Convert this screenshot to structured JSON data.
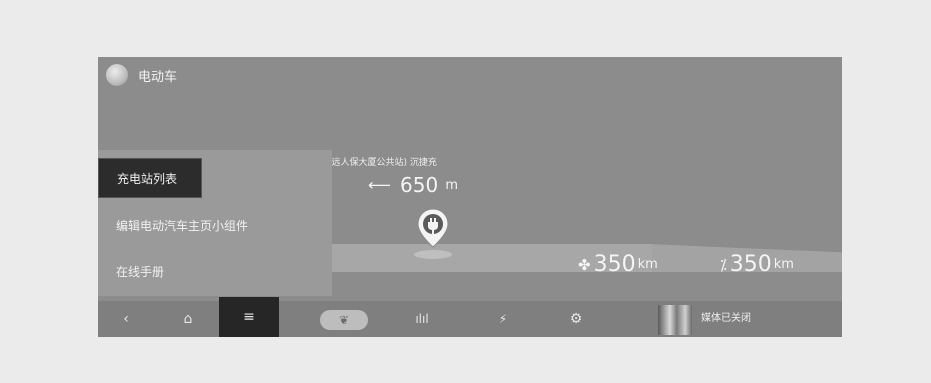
{
  "app": {
    "title": "电动车"
  },
  "map": {
    "station_label": "充电站(新源恒远人保大厦公共站)  沉捷充",
    "distance_value": "650",
    "distance_unit": "m"
  },
  "menu": {
    "items": [
      {
        "label": "充电站列表",
        "active": true
      },
      {
        "label": "编辑电动汽车主页小组件",
        "active": false
      },
      {
        "label": "在线手册",
        "active": false
      }
    ]
  },
  "range": [
    {
      "icon": "fan-icon",
      "value": "350",
      "unit": "km"
    },
    {
      "icon": "fan-off-icon",
      "value": "350",
      "unit": "km"
    }
  ],
  "navbar": {
    "back": "‹",
    "home": "⌂",
    "menu": "≡",
    "eco": "❦",
    "stats": "ılıl",
    "charge": "⚡",
    "settings": "⚙",
    "media_status": "媒体已关闭"
  },
  "colors": {
    "background": "#ebebeb",
    "screen": "#8c8c8c",
    "active_item": "#2c2c2c"
  }
}
